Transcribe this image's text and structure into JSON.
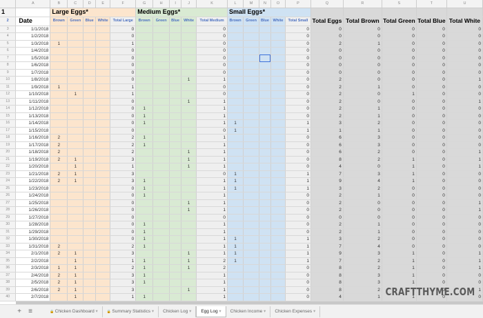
{
  "column_letters": [
    "A",
    "B",
    "C",
    "D",
    "E",
    "F",
    "G",
    "H",
    "I",
    "J",
    "K",
    "L",
    "M",
    "N",
    "O",
    "P",
    "Q",
    "R",
    "S",
    "T",
    "U"
  ],
  "groups": {
    "large": "Large Eggs*",
    "medium": "Medium Eggs*",
    "small": "Small Eggs*"
  },
  "headers": [
    "Date",
    "Brown",
    "Green",
    "Blue",
    "White",
    "Total Large",
    "Brown",
    "Green",
    "Blue",
    "White",
    "Total Medium",
    "Brown",
    "Green",
    "Blue",
    "White",
    "Total Small",
    "Total Eggs",
    "Total Brown",
    "Total Green",
    "Total Blue",
    "Total White"
  ],
  "rows": [
    [
      "1/1/2018",
      "",
      "",
      "",
      "",
      "0",
      "",
      "",
      "",
      "",
      "0",
      "",
      "",
      "",
      "",
      "0",
      "0",
      "0",
      "0",
      "0",
      "0"
    ],
    [
      "1/2/2018",
      "",
      "",
      "",
      "",
      "0",
      "",
      "",
      "",
      "",
      "0",
      "",
      "",
      "",
      "",
      "0",
      "0",
      "0",
      "0",
      "0",
      "0"
    ],
    [
      "1/3/2018",
      "1",
      "",
      "",
      "",
      "1",
      "",
      "",
      "",
      "",
      "0",
      "",
      "",
      "",
      "",
      "0",
      "2",
      "1",
      "0",
      "0",
      "0"
    ],
    [
      "1/4/2018",
      "",
      "",
      "",
      "",
      "0",
      "",
      "",
      "",
      "",
      "0",
      "",
      "",
      "",
      "",
      "0",
      "0",
      "0",
      "0",
      "0",
      "0"
    ],
    [
      "1/5/2018",
      "",
      "",
      "",
      "",
      "0",
      "",
      "",
      "",
      "",
      "0",
      "",
      "",
      "",
      "",
      "0",
      "0",
      "0",
      "0",
      "0",
      "0"
    ],
    [
      "1/6/2018",
      "",
      "",
      "",
      "",
      "0",
      "",
      "",
      "",
      "",
      "0",
      "",
      "",
      "",
      "",
      "0",
      "0",
      "0",
      "0",
      "0",
      "0"
    ],
    [
      "1/7/2018",
      "",
      "",
      "",
      "",
      "0",
      "",
      "",
      "",
      "",
      "0",
      "",
      "",
      "",
      "",
      "0",
      "0",
      "0",
      "0",
      "0",
      "0"
    ],
    [
      "1/8/2018",
      "",
      "",
      "",
      "",
      "0",
      "",
      "",
      "",
      "1",
      "1",
      "",
      "",
      "",
      "",
      "0",
      "2",
      "0",
      "0",
      "0",
      "1"
    ],
    [
      "1/9/2018",
      "1",
      "",
      "",
      "",
      "1",
      "",
      "",
      "",
      "",
      "0",
      "",
      "",
      "",
      "",
      "0",
      "2",
      "1",
      "0",
      "0",
      "0"
    ],
    [
      "1/10/2018",
      "",
      "1",
      "",
      "",
      "1",
      "",
      "",
      "",
      "",
      "0",
      "",
      "",
      "",
      "",
      "0",
      "2",
      "0",
      "1",
      "0",
      "0"
    ],
    [
      "1/11/2018",
      "",
      "",
      "",
      "",
      "0",
      "",
      "",
      "",
      "1",
      "1",
      "",
      "",
      "",
      "",
      "0",
      "2",
      "0",
      "0",
      "0",
      "1"
    ],
    [
      "1/12/2018",
      "",
      "",
      "",
      "",
      "0",
      "1",
      "",
      "",
      "",
      "1",
      "",
      "",
      "",
      "",
      "0",
      "2",
      "1",
      "0",
      "0",
      "0"
    ],
    [
      "1/13/2018",
      "",
      "",
      "",
      "",
      "0",
      "1",
      "",
      "",
      "",
      "1",
      "",
      "",
      "",
      "",
      "0",
      "2",
      "1",
      "0",
      "0",
      "0"
    ],
    [
      "1/14/2018",
      "",
      "",
      "",
      "",
      "0",
      "1",
      "",
      "",
      "",
      "1",
      "1",
      "",
      "",
      "",
      "1",
      "3",
      "2",
      "0",
      "0",
      "0"
    ],
    [
      "1/15/2018",
      "",
      "",
      "",
      "",
      "0",
      "",
      "",
      "",
      "",
      "0",
      "1",
      "",
      "",
      "",
      "1",
      "1",
      "1",
      "0",
      "0",
      "0"
    ],
    [
      "1/16/2018",
      "2",
      "",
      "",
      "",
      "2",
      "1",
      "",
      "",
      "",
      "1",
      "",
      "",
      "",
      "",
      "0",
      "6",
      "3",
      "0",
      "0",
      "0"
    ],
    [
      "1/17/2018",
      "2",
      "",
      "",
      "",
      "2",
      "1",
      "",
      "",
      "",
      "1",
      "",
      "",
      "",
      "",
      "0",
      "6",
      "3",
      "0",
      "0",
      "0"
    ],
    [
      "1/18/2018",
      "2",
      "",
      "",
      "",
      "2",
      "",
      "",
      "",
      "1",
      "1",
      "",
      "",
      "",
      "",
      "0",
      "6",
      "2",
      "0",
      "0",
      "1"
    ],
    [
      "1/19/2018",
      "2",
      "1",
      "",
      "",
      "3",
      "",
      "",
      "",
      "1",
      "1",
      "",
      "",
      "",
      "",
      "0",
      "8",
      "2",
      "1",
      "0",
      "1"
    ],
    [
      "1/20/2018",
      "",
      "1",
      "",
      "",
      "1",
      "",
      "",
      "",
      "1",
      "1",
      "",
      "",
      "",
      "",
      "0",
      "4",
      "0",
      "1",
      "0",
      "1"
    ],
    [
      "1/21/2018",
      "2",
      "1",
      "",
      "",
      "3",
      "",
      "",
      "",
      "",
      "0",
      "1",
      "",
      "",
      "",
      "1",
      "7",
      "3",
      "1",
      "0",
      "0"
    ],
    [
      "1/22/2018",
      "2",
      "1",
      "",
      "",
      "3",
      "1",
      "",
      "",
      "",
      "1",
      "1",
      "",
      "",
      "",
      "1",
      "9",
      "4",
      "1",
      "0",
      "0"
    ],
    [
      "1/23/2018",
      "",
      "",
      "",
      "",
      "0",
      "1",
      "",
      "",
      "",
      "1",
      "1",
      "",
      "",
      "",
      "1",
      "3",
      "2",
      "0",
      "0",
      "0"
    ],
    [
      "1/24/2018",
      "",
      "",
      "",
      "",
      "0",
      "1",
      "",
      "",
      "",
      "1",
      "",
      "",
      "",
      "",
      "0",
      "2",
      "1",
      "0",
      "0",
      "0"
    ],
    [
      "1/25/2018",
      "",
      "",
      "",
      "",
      "0",
      "",
      "",
      "",
      "1",
      "1",
      "",
      "",
      "",
      "",
      "0",
      "2",
      "0",
      "0",
      "0",
      "1"
    ],
    [
      "1/26/2018",
      "",
      "",
      "",
      "",
      "0",
      "",
      "",
      "",
      "1",
      "1",
      "",
      "",
      "",
      "",
      "0",
      "2",
      "0",
      "0",
      "0",
      "1"
    ],
    [
      "1/27/2018",
      "",
      "",
      "",
      "",
      "0",
      "",
      "",
      "",
      "",
      "0",
      "",
      "",
      "",
      "",
      "0",
      "0",
      "0",
      "0",
      "0",
      "0"
    ],
    [
      "1/28/2018",
      "",
      "",
      "",
      "",
      "0",
      "1",
      "",
      "",
      "",
      "1",
      "",
      "",
      "",
      "",
      "0",
      "2",
      "1",
      "0",
      "0",
      "0"
    ],
    [
      "1/29/2018",
      "",
      "",
      "",
      "",
      "0",
      "1",
      "",
      "",
      "",
      "1",
      "",
      "",
      "",
      "",
      "0",
      "2",
      "1",
      "0",
      "0",
      "0"
    ],
    [
      "1/30/2018",
      "",
      "",
      "",
      "",
      "0",
      "1",
      "",
      "",
      "",
      "1",
      "1",
      "",
      "",
      "",
      "1",
      "3",
      "2",
      "0",
      "0",
      "0"
    ],
    [
      "1/31/2018",
      "2",
      "",
      "",
      "",
      "2",
      "1",
      "",
      "",
      "",
      "1",
      "1",
      "",
      "",
      "",
      "1",
      "7",
      "4",
      "0",
      "0",
      "0"
    ],
    [
      "2/1/2018",
      "2",
      "1",
      "",
      "",
      "3",
      "",
      "",
      "",
      "1",
      "1",
      "1",
      "",
      "",
      "",
      "1",
      "9",
      "3",
      "1",
      "0",
      "1"
    ],
    [
      "2/2/2018",
      "",
      "1",
      "",
      "",
      "1",
      "1",
      "",
      "",
      "1",
      "2",
      "1",
      "",
      "",
      "",
      "1",
      "7",
      "2",
      "1",
      "0",
      "1"
    ],
    [
      "2/3/2018",
      "1",
      "1",
      "",
      "",
      "2",
      "1",
      "",
      "",
      "1",
      "2",
      "",
      "",
      "",
      "",
      "0",
      "8",
      "2",
      "1",
      "0",
      "1"
    ],
    [
      "2/4/2018",
      "2",
      "1",
      "",
      "",
      "3",
      "1",
      "",
      "",
      "",
      "1",
      "",
      "",
      "",
      "",
      "0",
      "8",
      "3",
      "1",
      "0",
      "0"
    ],
    [
      "2/5/2018",
      "2",
      "1",
      "",
      "",
      "3",
      "1",
      "",
      "",
      "",
      "1",
      "",
      "",
      "",
      "",
      "0",
      "8",
      "3",
      "1",
      "0",
      "0"
    ],
    [
      "2/6/2018",
      "2",
      "1",
      "",
      "",
      "3",
      "",
      "",
      "",
      "1",
      "1",
      "",
      "",
      "",
      "",
      "0",
      "8",
      "2",
      "1",
      "0",
      "1"
    ],
    [
      "2/7/2018",
      "",
      "1",
      "",
      "",
      "1",
      "1",
      "",
      "",
      "",
      "1",
      "",
      "",
      "",
      "",
      "0",
      "4",
      "1",
      "1",
      "0",
      "0"
    ]
  ],
  "tabs": [
    {
      "label": "Chicken Dashboard",
      "locked": true
    },
    {
      "label": "Summary Statistics",
      "locked": true
    },
    {
      "label": "Chicken Log"
    },
    {
      "label": "Egg Log",
      "active": true
    },
    {
      "label": "Chicken Income"
    },
    {
      "label": "Chicken Expenses"
    }
  ],
  "tab_controls": {
    "add": "+",
    "list": "≡"
  },
  "watermark": "CRAFTTHYME.COM"
}
